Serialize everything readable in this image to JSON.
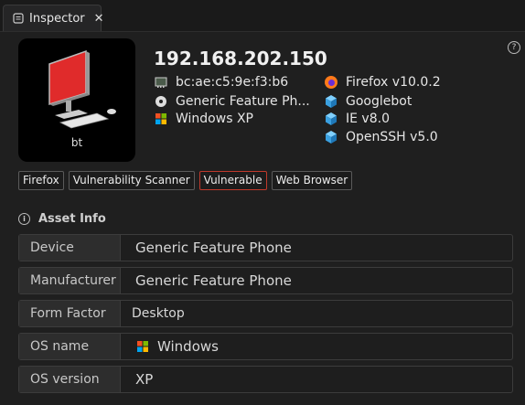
{
  "tab": {
    "label": "Inspector",
    "close": "✕"
  },
  "help": "?",
  "asset": {
    "caption": "bt",
    "ip": "192.168.202.150",
    "left_attrs": [
      {
        "icon": "network-card-icon",
        "text": "bc:ae:c5:9e:f3:b6"
      },
      {
        "icon": "disc-icon",
        "text": "Generic Feature Ph..."
      },
      {
        "icon": "windows-icon",
        "text": "Windows XP"
      }
    ],
    "right_attrs": [
      {
        "icon": "firefox-icon",
        "text": "Firefox v10.0.2"
      },
      {
        "icon": "cube-icon",
        "text": "Googlebot"
      },
      {
        "icon": "cube-icon",
        "text": "IE v8.0"
      },
      {
        "icon": "cube-icon",
        "text": "OpenSSH v5.0"
      }
    ]
  },
  "tags": [
    "Firefox",
    "Vulnerability Scanner",
    "Vulnerable",
    "Web Browser"
  ],
  "section": {
    "title": "Asset Info"
  },
  "info_rows": [
    {
      "key": "Device",
      "value": "Generic Feature Phone"
    },
    {
      "key": "Manufacturer",
      "value": "Generic Feature Phone"
    },
    {
      "key": "Form Factor",
      "value": "Desktop"
    },
    {
      "key": "OS name",
      "value": "Windows"
    },
    {
      "key": "OS version",
      "value": "XP"
    }
  ],
  "colors": {
    "accent_red": "#c0392b",
    "cube_blue": "#3aa0e0"
  }
}
